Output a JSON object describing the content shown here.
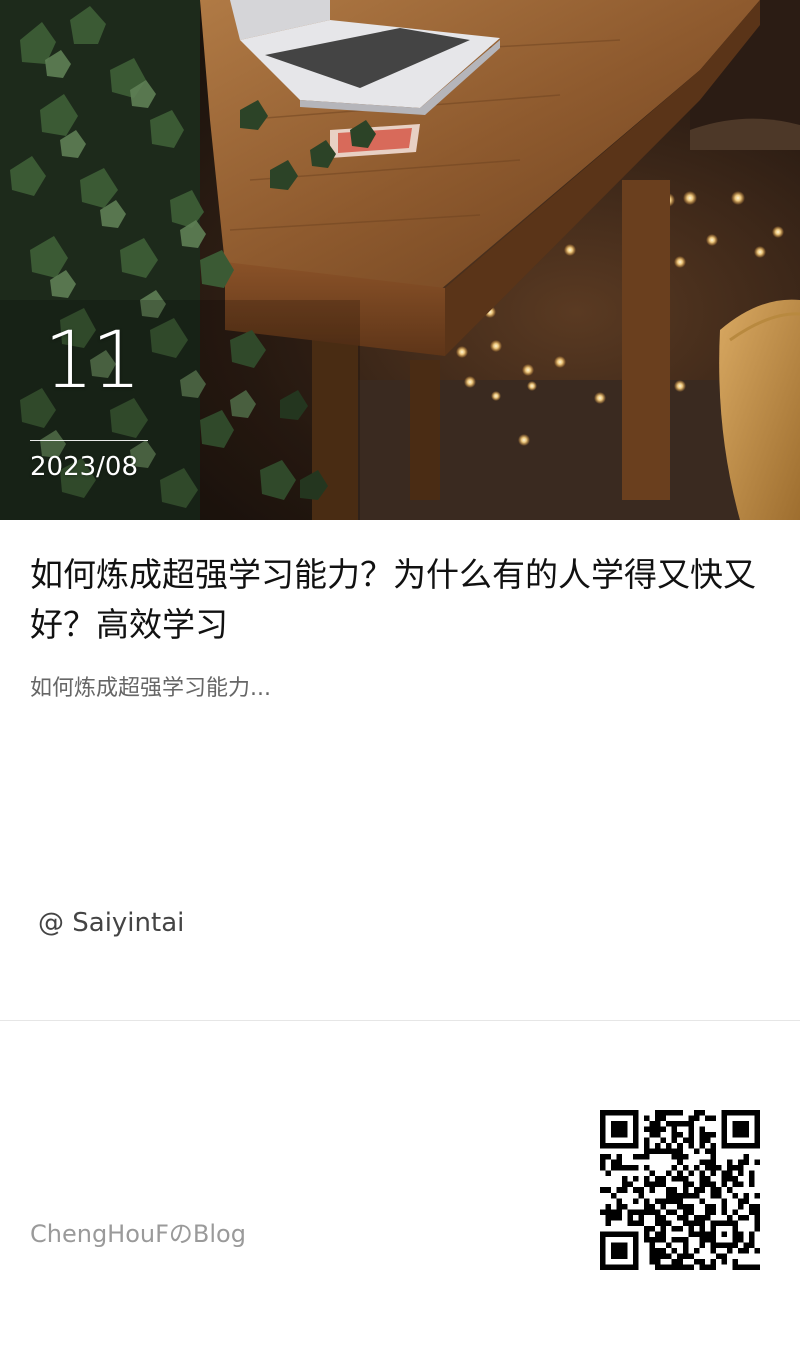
{
  "post": {
    "date_day": "11",
    "date_month": "2023/08",
    "title": "如何炼成超强学习能力？为什么有的人学得又快又好？高效学习",
    "excerpt": "如何炼成超强学习能力...",
    "author": "@ Saiyintai"
  },
  "footer": {
    "blog_name": "ChengHouFのBlog"
  },
  "colors": {
    "title": "#111111",
    "excerpt": "#666666",
    "author": "#444444",
    "blog_name": "#9a9a9a",
    "qr": "#000000"
  },
  "icons": {
    "cover": "desk-with-laptop-and-ivy-photo",
    "qr": "qr-code-icon"
  }
}
